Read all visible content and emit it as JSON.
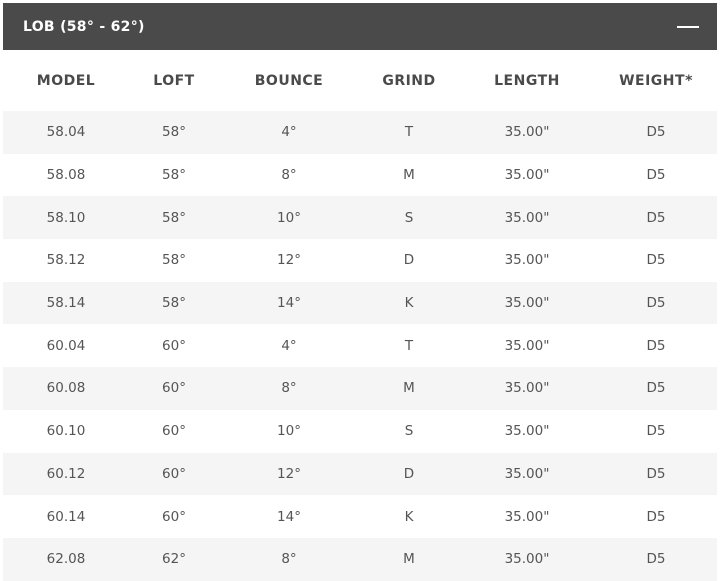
{
  "section": {
    "title": "LOB (58° - 62°)",
    "collapse_icon": "minus-icon"
  },
  "table": {
    "headers": [
      "MODEL",
      "LOFT",
      "BOUNCE",
      "GRIND",
      "LENGTH",
      "WEIGHT*"
    ],
    "rows": [
      [
        "58.04",
        "58°",
        "4°",
        "T",
        "35.00\"",
        "D5"
      ],
      [
        "58.08",
        "58°",
        "8°",
        "M",
        "35.00\"",
        "D5"
      ],
      [
        "58.10",
        "58°",
        "10°",
        "S",
        "35.00\"",
        "D5"
      ],
      [
        "58.12",
        "58°",
        "12°",
        "D",
        "35.00\"",
        "D5"
      ],
      [
        "58.14",
        "58°",
        "14°",
        "K",
        "35.00\"",
        "D5"
      ],
      [
        "60.04",
        "60°",
        "4°",
        "T",
        "35.00\"",
        "D5"
      ],
      [
        "60.08",
        "60°",
        "8°",
        "M",
        "35.00\"",
        "D5"
      ],
      [
        "60.10",
        "60°",
        "10°",
        "S",
        "35.00\"",
        "D5"
      ],
      [
        "60.12",
        "60°",
        "12°",
        "D",
        "35.00\"",
        "D5"
      ],
      [
        "60.14",
        "60°",
        "14°",
        "K",
        "35.00\"",
        "D5"
      ],
      [
        "62.08",
        "62°",
        "8°",
        "M",
        "35.00\"",
        "D5"
      ]
    ]
  },
  "colors": {
    "header_bg": "#4a4a4a",
    "stripe": "#f5f5f5",
    "text": "#555555"
  }
}
